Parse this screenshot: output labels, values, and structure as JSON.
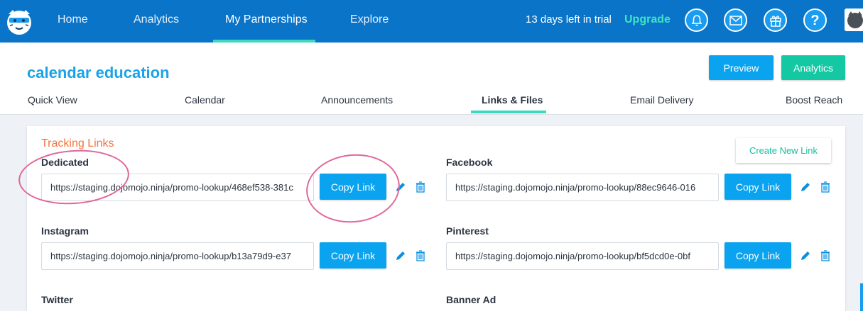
{
  "nav": {
    "items": [
      "Home",
      "Analytics",
      "My Partnerships",
      "Explore"
    ],
    "active": "My Partnerships",
    "trial_text": "13 days left in trial",
    "upgrade_label": "Upgrade",
    "icons": [
      "bell-icon",
      "mail-icon",
      "gift-icon",
      "help-icon"
    ],
    "help_glyph": "?"
  },
  "header": {
    "title": "calendar education",
    "preview_label": "Preview",
    "analytics_label": "Analytics",
    "tabs": [
      "Quick View",
      "Calendar",
      "Announcements",
      "Links & Files",
      "Email Delivery",
      "Boost Reach"
    ],
    "active_tab": "Links & Files"
  },
  "tracking": {
    "title": "Tracking Links",
    "create_label": "Create New Link",
    "copy_label": "Copy Link",
    "links": [
      {
        "label": "Dedicated",
        "url": "https://staging.dojomojo.ninja/promo-lookup/468ef538-381c"
      },
      {
        "label": "Facebook",
        "url": "https://staging.dojomojo.ninja/promo-lookup/88ec9646-016"
      },
      {
        "label": "Instagram",
        "url": "https://staging.dojomojo.ninja/promo-lookup/b13a79d9-e37"
      },
      {
        "label": "Pinterest",
        "url": "https://staging.dojomojo.ninja/promo-lookup/bf5dcd0e-0bf"
      },
      {
        "label": "Twitter",
        "url": ""
      },
      {
        "label": "Banner Ad",
        "url": ""
      }
    ]
  },
  "colors": {
    "nav_bg": "#0a74c9",
    "accent_teal": "#3fd7c0",
    "primary_blue": "#0aa3f0",
    "title_orange": "#f2743e",
    "annotation_pink": "#e0679a"
  }
}
